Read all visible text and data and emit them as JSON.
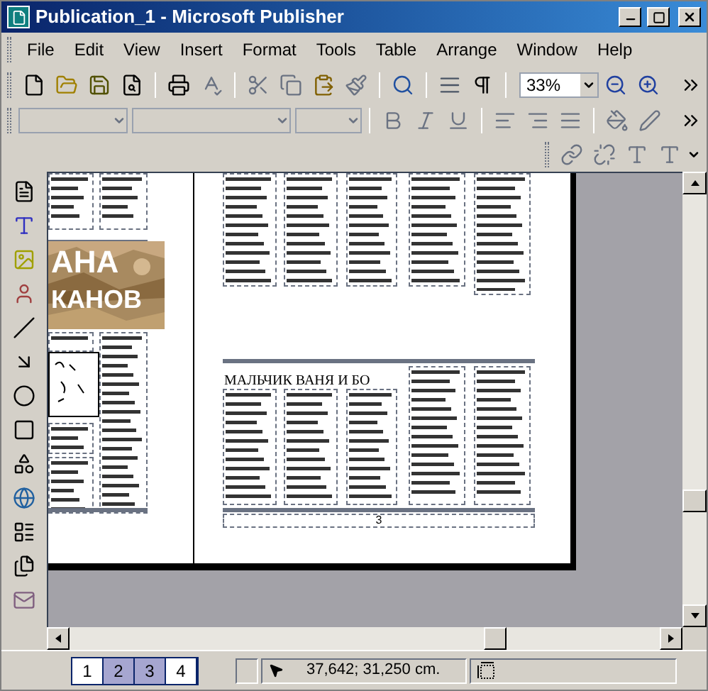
{
  "window": {
    "title": "Publication_1 - Microsoft Publisher"
  },
  "menu": [
    "File",
    "Edit",
    "View",
    "Insert",
    "Format",
    "Tools",
    "Table",
    "Arrange",
    "Window",
    "Help"
  ],
  "standard_toolbar": {
    "zoom": "33%"
  },
  "document": {
    "banner": [
      "АНА",
      "КАНОВ"
    ],
    "headline": "МАЛЬЧИК ВАНЯ И БО",
    "page_number": "3"
  },
  "page_tabs": [
    {
      "label": "1",
      "selected": false
    },
    {
      "label": "2",
      "selected": true
    },
    {
      "label": "3",
      "selected": true
    },
    {
      "label": "4",
      "selected": false
    }
  ],
  "status_bar": {
    "position": "37,642; 31,250 cm."
  }
}
